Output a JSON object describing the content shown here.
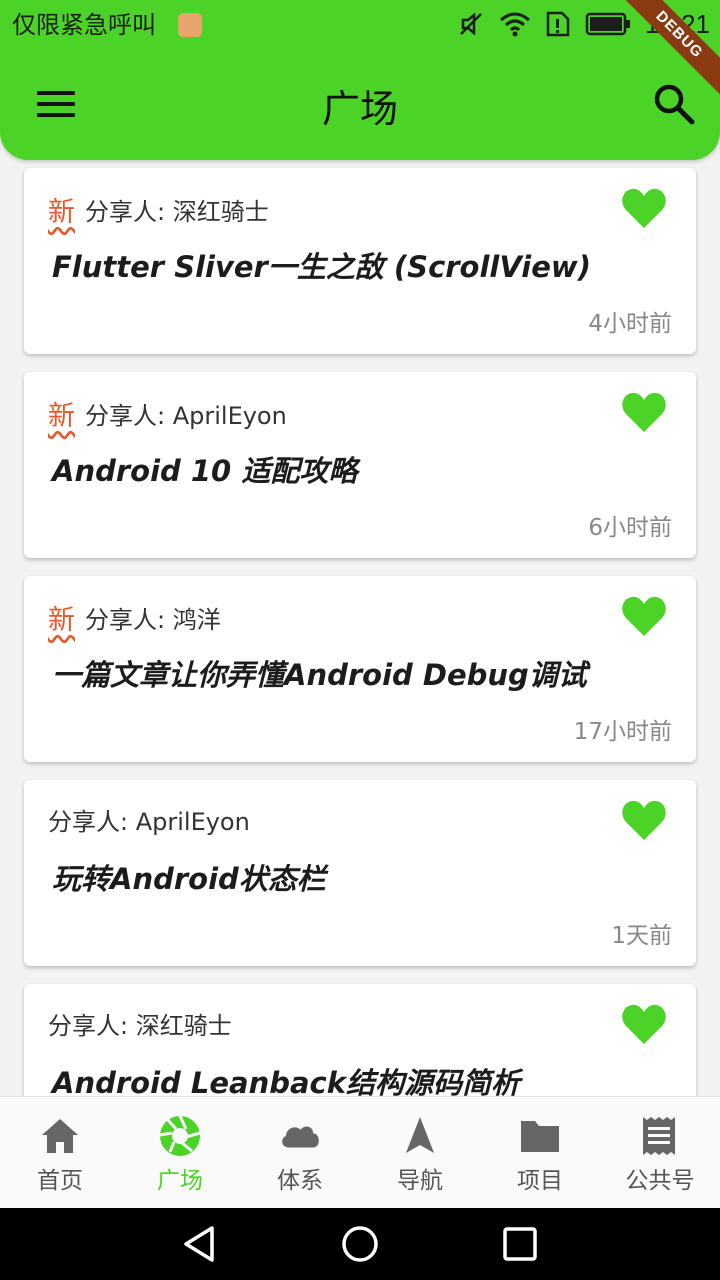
{
  "status_bar": {
    "carrier": "仅限紧急呼叫",
    "time": "15:21",
    "debug_label": "DEBUG"
  },
  "app_bar": {
    "title": "广场"
  },
  "colors": {
    "brand": "#4cd327",
    "new_tag": "#e25b2b",
    "favorite": "#4cd327"
  },
  "posts": [
    {
      "is_new": true,
      "new_label": "新",
      "sharer": "分享人: 深红骑士",
      "title": "Flutter  Sliver一生之敌 (ScrollView)",
      "time": "4小时前",
      "favorite_icon": "heart-icon"
    },
    {
      "is_new": true,
      "new_label": "新",
      "sharer": "分享人: AprilEyon",
      "title": "Android  10  适配攻略",
      "time": "6小时前",
      "favorite_icon": "heart-icon"
    },
    {
      "is_new": true,
      "new_label": "新",
      "sharer": "分享人: 鸿洋",
      "title": "一篇文章让你弄懂Android  Debug调试",
      "time": "17小时前",
      "favorite_icon": "heart-icon"
    },
    {
      "is_new": false,
      "new_label": "",
      "sharer": "分享人: AprilEyon",
      "title": "玩转Android状态栏",
      "time": "1天前",
      "favorite_icon": "heart-icon"
    },
    {
      "is_new": false,
      "new_label": "",
      "sharer": "分享人: 深红骑士",
      "title": "Android  Leanback结构源码简析",
      "time": "",
      "favorite_icon": "heart-icon"
    }
  ],
  "bottom_nav": {
    "active": "广场",
    "items": [
      {
        "label": "首页",
        "icon": "home-icon"
      },
      {
        "label": "广场",
        "icon": "aperture-icon"
      },
      {
        "label": "体系",
        "icon": "cloud-icon"
      },
      {
        "label": "导航",
        "icon": "navigation-icon"
      },
      {
        "label": "项目",
        "icon": "folder-icon"
      },
      {
        "label": "公共号",
        "icon": "receipt-icon"
      }
    ]
  }
}
